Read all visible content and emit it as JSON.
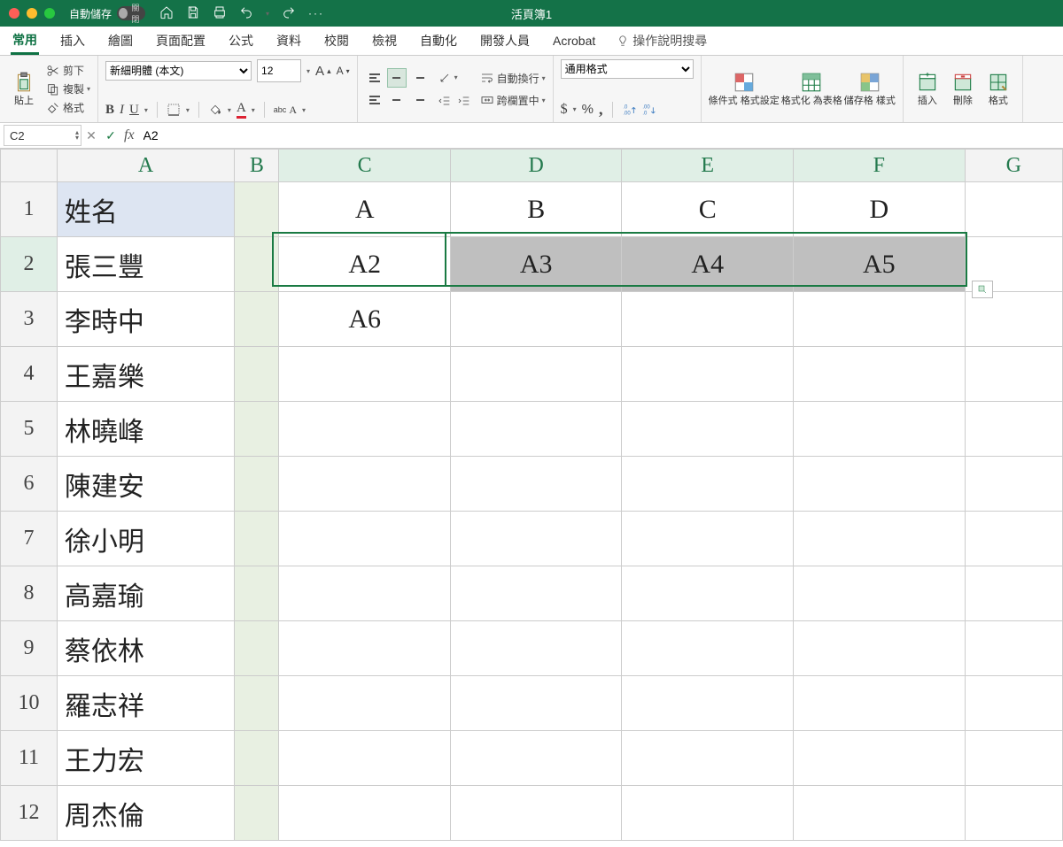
{
  "titlebar": {
    "autosave_label": "自動儲存",
    "autosave_state": "關閉",
    "doc_title": "活頁簿1"
  },
  "tabs": [
    "常用",
    "插入",
    "繪圖",
    "頁面配置",
    "公式",
    "資料",
    "校閱",
    "檢視",
    "自動化",
    "開發人員",
    "Acrobat"
  ],
  "tellme": "操作說明搜尋",
  "clipboard": {
    "paste": "貼上",
    "cut": "剪下",
    "copy": "複製",
    "format": "格式"
  },
  "font": {
    "name": "新細明體 (本文)",
    "size": "12"
  },
  "alignment": {
    "wrap": "自動換行",
    "merge": "跨欄置中"
  },
  "number": {
    "format": "通用格式"
  },
  "styles": {
    "cond": "條件式\n格式設定",
    "table": "格式化\n為表格",
    "cell": "儲存格\n樣式"
  },
  "cells": {
    "insert": "插入",
    "delete": "刪除",
    "format": "格式"
  },
  "namebox": "C2",
  "formula": "A2",
  "columns": [
    "A",
    "B",
    "C",
    "D",
    "E",
    "F",
    "G"
  ],
  "colwidths": {
    "A": 195,
    "B": 48,
    "C": 195,
    "D": 195,
    "E": 195,
    "F": 195,
    "G": 110
  },
  "data": {
    "A1": "姓名",
    "C1": "A",
    "D1": "B",
    "E1": "C",
    "F1": "D",
    "A2": "張三豐",
    "C2": "A2",
    "D2": "A3",
    "E2": "A4",
    "F2": "A5",
    "A3": "李時中",
    "C3": "A6",
    "A4": "王嘉樂",
    "A5": "林曉峰",
    "A6": "陳建安",
    "A7": "徐小明",
    "A8": "高嘉瑜",
    "A9": "蔡依林",
    "A10": "羅志祥",
    "A11": "王力宏",
    "A12": "周杰倫"
  },
  "selected_columns": [
    "C",
    "D",
    "E",
    "F"
  ],
  "selected_row": 2,
  "active_cell": "C2",
  "row_count": 12
}
